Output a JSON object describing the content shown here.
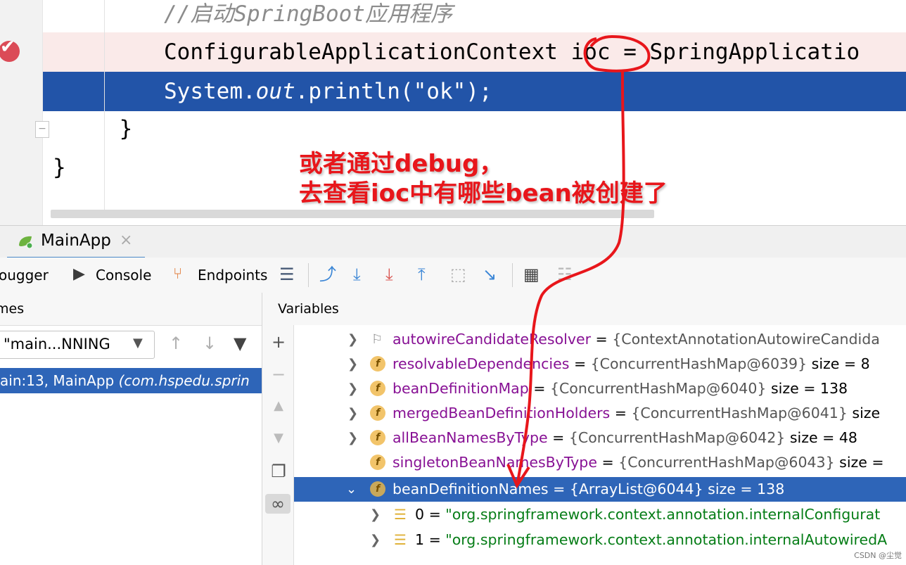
{
  "editor": {
    "comment": "//启动SpringBoot应用程序",
    "ctx_line": "ConfigurableApplicationContext ioc = SpringApplicatio",
    "println_pre": "System.",
    "println_out": "out",
    "println_post": ".println(\"ok\");",
    "brace_inner": "    }",
    "brace_outer": "}"
  },
  "annotation": {
    "line1": "或者通过debug，",
    "line2": "去查看ioc中有哪些bean被创建了"
  },
  "run_tab": {
    "label": "MainApp",
    "close": "×"
  },
  "toolbar": {
    "debugger_label": "ougger",
    "console_label": "Console",
    "endpoints_label": "Endpoints"
  },
  "frames": {
    "title": "mes",
    "thread_value": "\"main...NNING",
    "frame_row": "ain:13, MainApp ",
    "frame_row_pkg": "(com.hspedu.sprin"
  },
  "variables": {
    "title": "Variables",
    "rows": [
      {
        "name": "autowireCandidateResolver",
        "eq": " = ",
        "value": "{ContextAnnotationAutowireCandida",
        "size": ""
      },
      {
        "name": "resolvableDependencies",
        "eq": " = ",
        "value": "{ConcurrentHashMap@6039}",
        "size": "  size = 8"
      },
      {
        "name": "beanDefinitionMap",
        "eq": " = ",
        "value": "{ConcurrentHashMap@6040}",
        "size": "  size = 138"
      },
      {
        "name": "mergedBeanDefinitionHolders",
        "eq": " = ",
        "value": "{ConcurrentHashMap@6041}",
        "size": "  size"
      },
      {
        "name": "allBeanNamesByType",
        "eq": " = ",
        "value": "{ConcurrentHashMap@6042}",
        "size": "  size = 48"
      },
      {
        "name": "singletonBeanNamesByType",
        "eq": " = ",
        "value": "{ConcurrentHashMap@6043}",
        "size": "  size ="
      },
      {
        "name": "beanDefinitionNames",
        "eq": " = ",
        "value": "{ArrayList@6044}",
        "size": "  size = 138"
      }
    ],
    "children": [
      {
        "index": "0",
        "eq": " = ",
        "value": "\"org.springframework.context.annotation.internalConfigurat"
      },
      {
        "index": "1",
        "eq": " = ",
        "value": "\"org.springframework.context.annotation.internalAutowiredA"
      }
    ]
  },
  "watermark": "CSDN @尘觉",
  "colors": {
    "selection": "#2e65b8",
    "annotation_red": "#e8161b",
    "breakpoint": "#db4b57"
  }
}
